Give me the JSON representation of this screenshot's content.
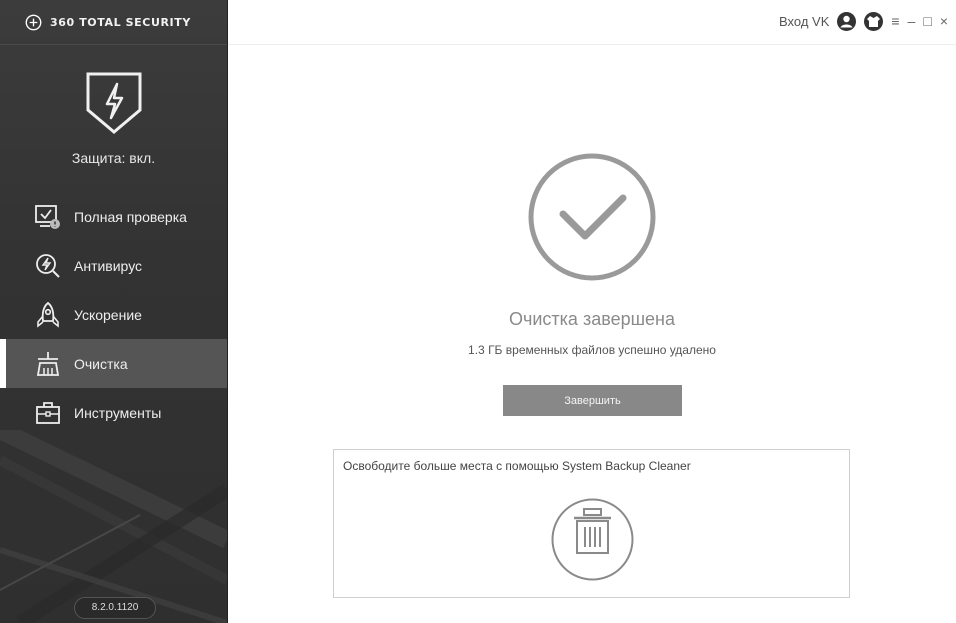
{
  "app": {
    "brand": "360 TOTAL SECURITY",
    "protection_status": "Защита: вкл.",
    "version": "8.2.0.1120"
  },
  "sidebar": {
    "items": [
      {
        "label": "Полная проверка",
        "icon": "full-scan-icon",
        "active": false
      },
      {
        "label": "Антивирус",
        "icon": "antivirus-icon",
        "active": false
      },
      {
        "label": "Ускорение",
        "icon": "rocket-icon",
        "active": false
      },
      {
        "label": "Очистка",
        "icon": "broom-icon",
        "active": true
      },
      {
        "label": "Инструменты",
        "icon": "toolbox-icon",
        "active": false
      }
    ]
  },
  "titlebar": {
    "login": "Вход VK",
    "icons": [
      "user-icon",
      "skin-icon",
      "menu-icon",
      "minimize-icon",
      "maximize-icon",
      "close-icon"
    ],
    "menu_glyph": "≡",
    "minimize_glyph": "–",
    "maximize_glyph": "□",
    "close_glyph": "×"
  },
  "main": {
    "result_title": "Очистка завершена",
    "result_subtitle": "1.3 ГБ временных файлов успешно удалено",
    "finish_button": "Завершить",
    "promo_text": "Освободите больше места с помощью System Backup Cleaner"
  },
  "colors": {
    "sidebar_bg": "#333333",
    "active_item_bg": "#555555",
    "button_bg": "#888888",
    "check_color": "#999999"
  }
}
